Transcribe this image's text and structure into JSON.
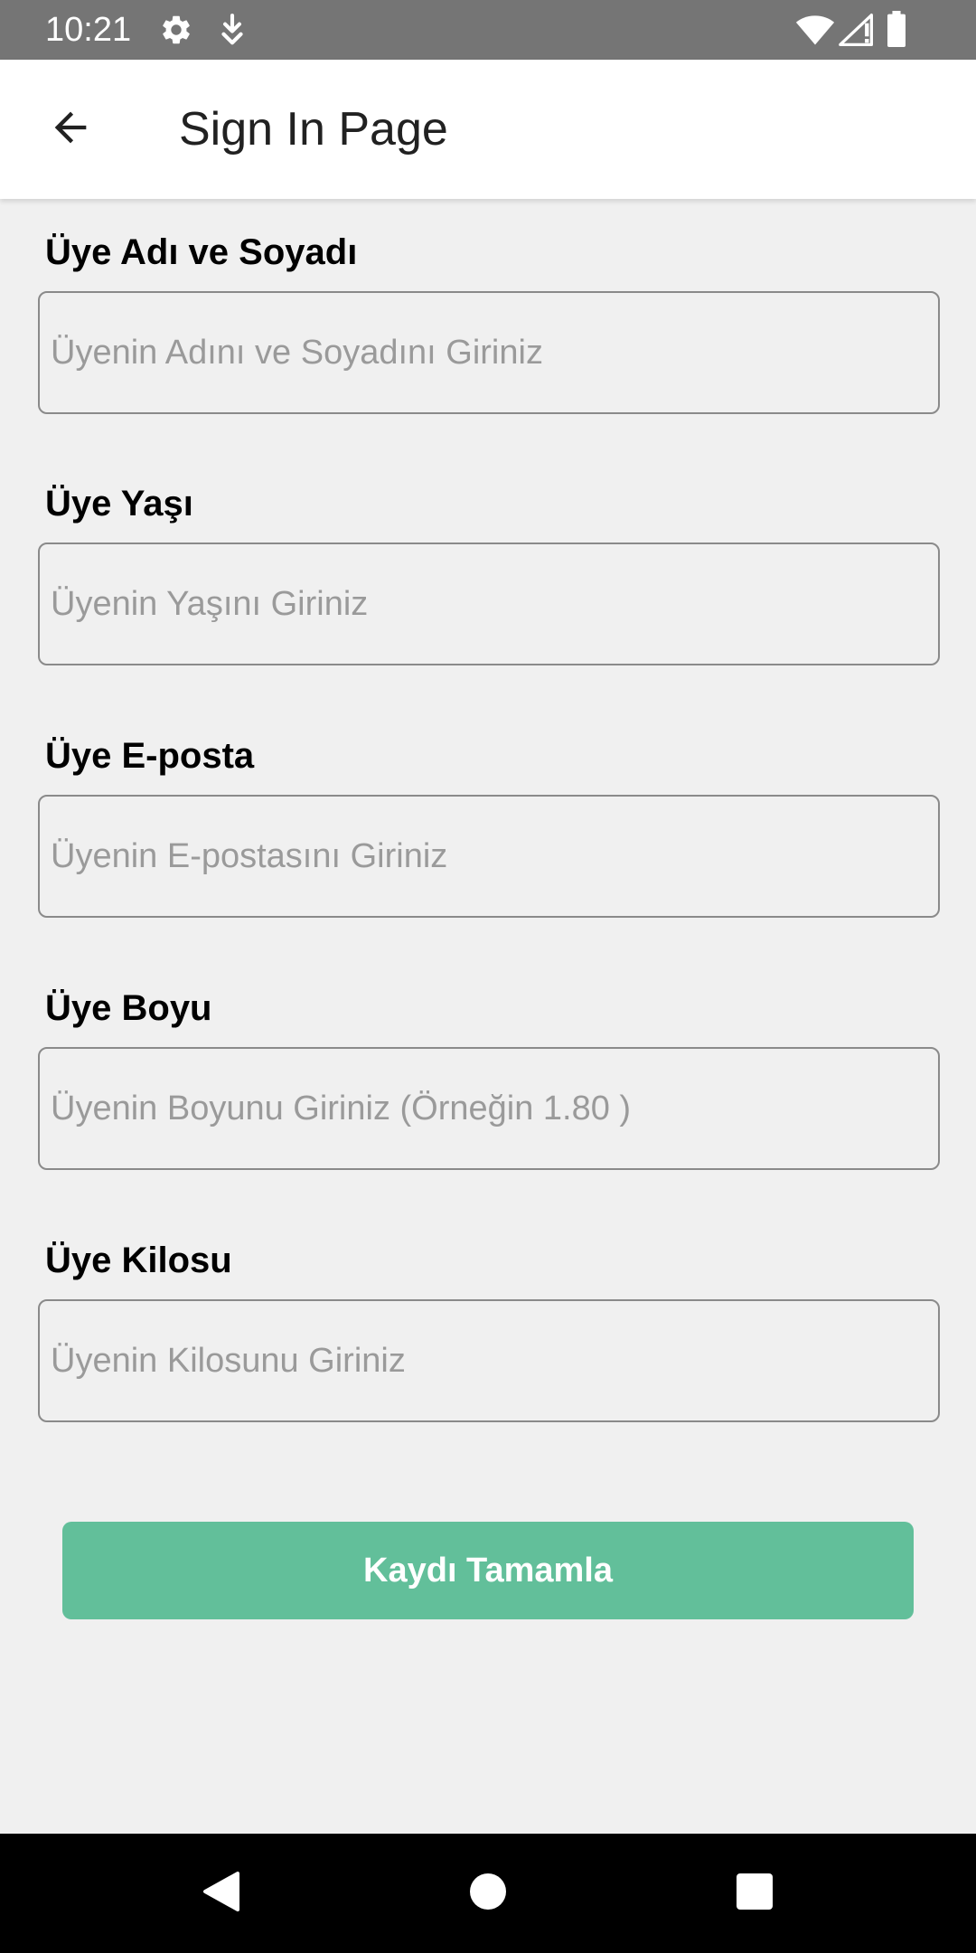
{
  "status_bar": {
    "time": "10:21",
    "icons": [
      "gear-icon",
      "download-icon",
      "wifi-icon",
      "signal-icon",
      "battery-icon"
    ]
  },
  "app_bar": {
    "title": "Sign In Page",
    "back_icon": "arrow-back-icon"
  },
  "form": {
    "fields": [
      {
        "label": "Üye Adı ve Soyadı",
        "placeholder": "Üyenin Adını ve Soyadını Giriniz",
        "value": ""
      },
      {
        "label": "Üye Yaşı",
        "placeholder": "Üyenin Yaşını Giriniz",
        "value": ""
      },
      {
        "label": "Üye E-posta",
        "placeholder": "Üyenin E-postasını Giriniz",
        "value": ""
      },
      {
        "label": "Üye Boyu",
        "placeholder": "Üyenin Boyunu Giriniz (Örneğin 1.80 )",
        "value": ""
      },
      {
        "label": "Üye Kilosu",
        "placeholder": "Üyenin Kilosunu Giriniz",
        "value": ""
      }
    ],
    "submit_label": "Kaydı Tamamla"
  },
  "colors": {
    "status_bar": "#757575",
    "accent_button": "#62bf9a",
    "background": "#f0f0f0"
  },
  "nav_bar": {
    "icons": [
      "back-triangle-icon",
      "home-circle-icon",
      "recents-square-icon"
    ]
  }
}
